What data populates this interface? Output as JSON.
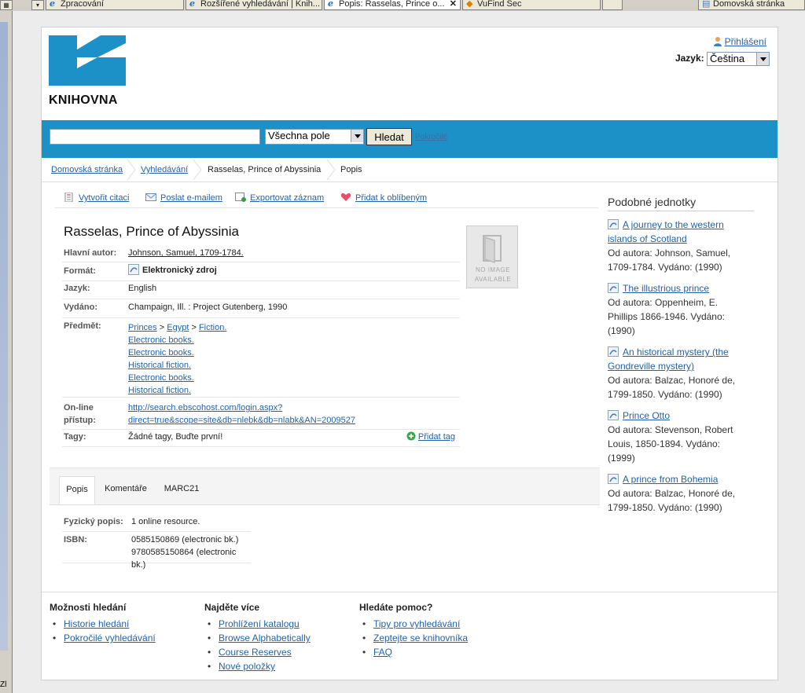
{
  "browser": {
    "tabs": [
      {
        "label": "Zpracování",
        "active": false
      },
      {
        "label": "Rozšířené vyhledávání | Knih...",
        "active": false
      },
      {
        "label": "Popis: Rasselas, Prince o...",
        "active": true
      },
      {
        "label": "VuFind Sec",
        "active": false
      },
      {
        "label": "Domovská stránka",
        "active": false
      }
    ],
    "side_text": "Zl"
  },
  "header": {
    "logo_text": "KNIHOVNA",
    "login_label": "Přihlášení",
    "language_label": "Jazyk:",
    "language_value": "Čeština"
  },
  "search": {
    "input_value": "",
    "field_value": "Všechna pole",
    "button_label": "Hledat",
    "advanced_label": "Pokročilé"
  },
  "breadcrumb": {
    "home": "Domovská stránka",
    "search": "Vyhledávání",
    "record": "Rasselas, Prince of Abyssinia",
    "current": "Popis"
  },
  "toolbar": {
    "cite": "Vytvořit citaci",
    "email": "Poslat e-mailem",
    "export": "Exportovat záznam",
    "favorite": "Přidat k oblíbeným"
  },
  "record": {
    "title": "Rasselas, Prince of Abyssinia",
    "author_label": "Hlavní autor:",
    "author": "Johnson, Samuel, 1709-1784.",
    "format_label": "Formát:",
    "format": "Elektronický zdroj",
    "language_label": "Jazyk:",
    "language": "English",
    "published_label": "Vydáno:",
    "published": "Champaign, Ill. : Project Gutenberg, 1990",
    "subject_label": "Předmět:",
    "subject_first": [
      "Princes",
      "Egypt",
      "Fiction."
    ],
    "subject_sep": ">",
    "subjects": [
      "Electronic books.",
      "Electronic books.",
      "Historical fiction.",
      "Electronic books.",
      "Historical fiction."
    ],
    "online_label_1": "On-line",
    "online_label_2": "přístup:",
    "online_url_1": "http://search.ebscohost.com/login.aspx?",
    "online_url_2": "direct=true&scope=site&db=nlebk&db=nlabk&AN=2009527",
    "tags_label": "Tagy:",
    "tags": "Žádné tagy, Buďte první!",
    "add_tag": "Přidat tag",
    "noimage_line1": "NO IMAGE",
    "noimage_line2": "AVAILABLE"
  },
  "detail_tabs": {
    "description": "Popis",
    "comments": "Komentáře",
    "marc": "MARC21"
  },
  "details": {
    "physical_label": "Fyzický popis:",
    "physical": "1 online resource.",
    "isbn_label": "ISBN:",
    "isbn_1": "0585150869 (electronic bk.)",
    "isbn_2": "9780585150864 (electronic bk.)"
  },
  "similar": {
    "title": "Podobné jednotky",
    "items": [
      {
        "title": "A journey to the western islands of Scotland",
        "by": "Od autora: Johnson, Samuel, 1709-1784. Vydáno: (1990)"
      },
      {
        "title": "The illustrious prince",
        "by": "Od autora: Oppenheim, E. Phillips 1866-1946. Vydáno: (1990)"
      },
      {
        "title": "An historical mystery (the Gondreville mystery)",
        "by": "Od autora: Balzac, Honoré de, 1799-1850. Vydáno: (1990)"
      },
      {
        "title": "Prince Otto",
        "by": "Od autora: Stevenson, Robert Louis, 1850-1894. Vydáno: (1999)"
      },
      {
        "title": "A prince from Bohemia",
        "by": "Od autora: Balzac, Honoré de, 1799-1850. Vydáno: (1990)"
      }
    ]
  },
  "footer": {
    "col1": {
      "title": "Možnosti hledání",
      "links": [
        "Historie hledání",
        "Pokročilé vyhledávání"
      ]
    },
    "col2": {
      "title": "Najděte více",
      "links": [
        "Prohlížení katalogu",
        "Browse Alphabetically",
        "Course Reserves",
        "Nové položky"
      ]
    },
    "col3": {
      "title": "Hledáte pomoc?",
      "links": [
        "Tipy pro vyhledávání",
        "Zeptejte se knihovníka",
        "FAQ"
      ]
    }
  },
  "colors": {
    "brand_blue": "#1c91c8",
    "link": "#2262ad"
  }
}
